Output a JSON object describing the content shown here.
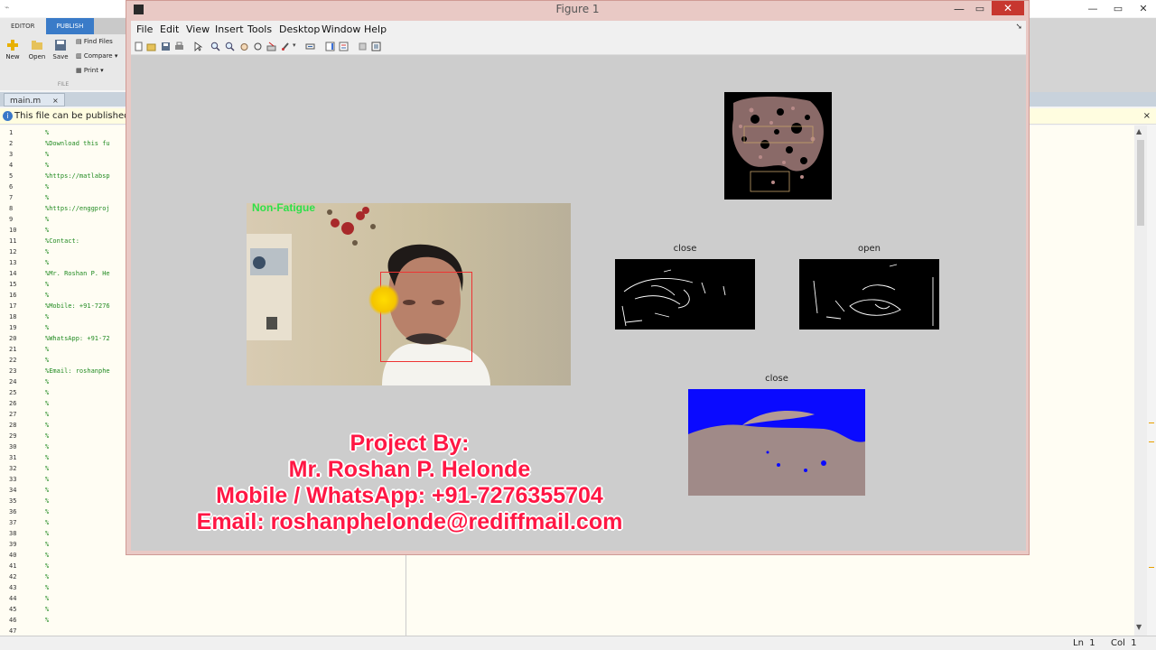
{
  "background_app": {
    "ribbon_tabs": [
      "EDITOR",
      "PUBLISH"
    ],
    "ribbon_buttons": [
      {
        "label": "New",
        "icon": "new-plus-icon"
      },
      {
        "label": "Open",
        "icon": "open-folder-icon"
      },
      {
        "label": "Save",
        "icon": "save-disk-icon"
      }
    ],
    "ribbon_small_buttons": [
      {
        "label": "Find Files",
        "icon": "find-files-icon"
      },
      {
        "label": "Compare",
        "icon": "compare-icon"
      },
      {
        "label": "Print",
        "icon": "print-icon"
      }
    ],
    "ribbon_group_label": "FILE",
    "file_tab": "main.m",
    "file_tab_close": "×",
    "info_bar_text": "This file can be published to",
    "info_bar_close": "×",
    "line_numbers": [
      "1",
      "2",
      "3",
      "4",
      "5",
      "6",
      "7",
      "8",
      "9",
      "10",
      "11",
      "12",
      "13",
      "14",
      "15",
      "16",
      "17",
      "18",
      "19",
      "20",
      "21",
      "22",
      "23",
      "24",
      "25",
      "26",
      "27",
      "28",
      "29",
      "30",
      "31",
      "32",
      "33",
      "34",
      "35",
      "36",
      "37",
      "38",
      "39",
      "40",
      "41",
      "42",
      "43",
      "44",
      "45",
      "46",
      "47"
    ],
    "code_lines": [
      "%",
      "%Download this fu",
      "%",
      "%",
      "%https://matlabsp",
      "%",
      "%",
      "%https://enggproj",
      "%",
      "%",
      "%Contact:",
      "%",
      "%",
      "%Mr. Roshan P. He",
      "%",
      "%",
      "%Mobile: +91-7276",
      "%",
      "%",
      "%WhatsApp: +91-72",
      "%",
      "%",
      "%Email: roshanphe",
      "%",
      "%",
      "%",
      "%",
      "%",
      "%",
      "%",
      "%",
      "%",
      "%",
      "%",
      "%",
      "%",
      "%",
      "%",
      "%",
      "%",
      "%",
      "%",
      "%",
      "%",
      "%",
      "%"
    ],
    "status": {
      "ln_label": "Ln",
      "ln_value": "1",
      "col_label": "Col",
      "col_value": "1"
    }
  },
  "figure_window": {
    "title": "Figure 1",
    "menu": [
      "File",
      "Edit",
      "View",
      "Insert",
      "Tools",
      "Desktop",
      "Window",
      "Help"
    ],
    "toolbar_icons": [
      "new-figure-icon",
      "open-file-icon",
      "save-figure-icon",
      "print-figure-icon",
      "edit-plot-icon",
      "zoom-in-icon",
      "zoom-out-icon",
      "pan-icon",
      "rotate-3d-icon",
      "data-cursor-icon",
      "brush-icon",
      "link-plot-icon",
      "insert-colorbar-icon",
      "insert-legend-icon",
      "hide-plot-tools-icon",
      "show-plot-tools-icon"
    ],
    "main_image_label": "Non-Fatigue",
    "axes": [
      {
        "title": "close",
        "content": "edge-map"
      },
      {
        "title": "open",
        "content": "edge-map"
      },
      {
        "title": "close",
        "content": "segmented-mouth"
      }
    ],
    "credits": [
      "Project By:",
      "Mr. Roshan P. Helonde",
      "Mobile / WhatsApp: +91-7276355704",
      "Email: roshanphelonde@rediffmail.com"
    ]
  },
  "colors": {
    "credits_text": "#ff1744",
    "label_green": "#2ee04a",
    "box_red": "#e33333",
    "close_button": "#c7372f",
    "segment_blue": "#0a0aff"
  }
}
